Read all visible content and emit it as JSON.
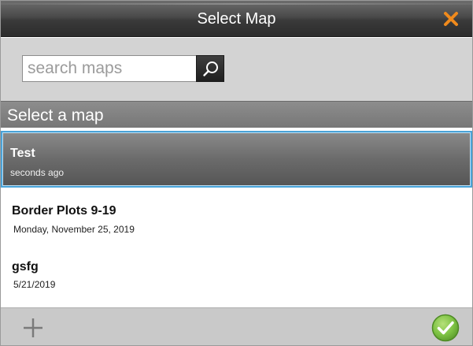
{
  "window": {
    "title": "Select Map",
    "close_icon": "close-icon",
    "accent_color": "#f08a1c"
  },
  "search": {
    "placeholder": "search maps",
    "value": "",
    "icon": "search-icon"
  },
  "section": {
    "title": "Select a map"
  },
  "maps": [
    {
      "name": "Test",
      "date": "seconds ago",
      "selected": true
    },
    {
      "name": "Border Plots 9-19",
      "date": "Monday, November 25, 2019",
      "selected": false
    },
    {
      "name": "gsfg",
      "date": "5/21/2019",
      "selected": false
    }
  ],
  "footer": {
    "add_icon": "plus-icon",
    "confirm_icon": "checkmark-icon",
    "confirm_color": "#7dc243",
    "selection_color": "#4aa3d8"
  }
}
